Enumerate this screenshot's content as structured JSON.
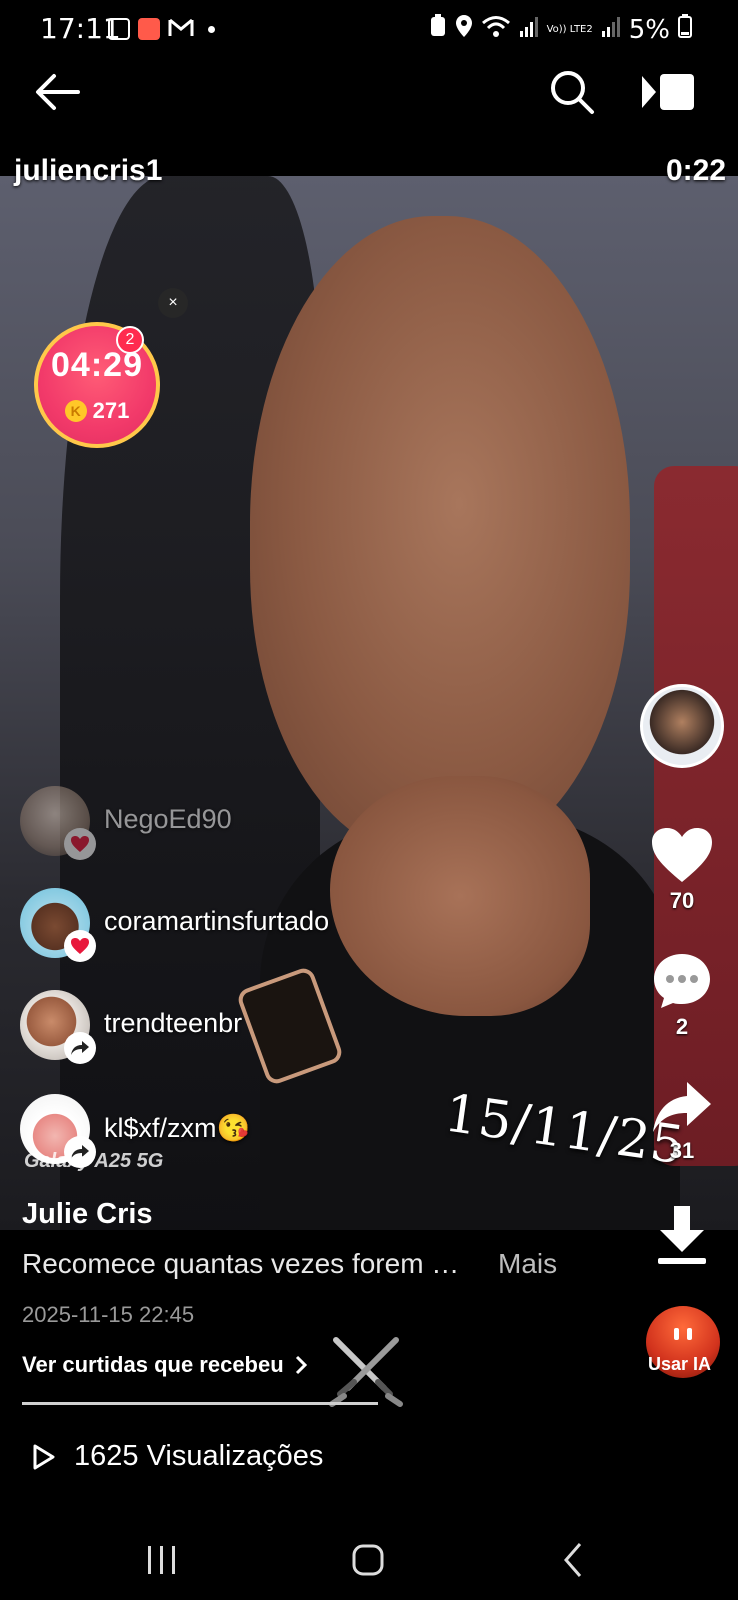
{
  "status_bar": {
    "time": "17:11",
    "battery": "5%",
    "network_label": "Vo)) LTE2"
  },
  "video": {
    "uploader": "juliencris1",
    "duration": "0:22",
    "overlay_date": "15/11/25",
    "device_tag": "Galaxy A25 5G"
  },
  "timer_widget": {
    "time": "04:29",
    "coins": "271",
    "coin_symbol": "K",
    "badge_count": "2",
    "close_symbol": "×"
  },
  "activity_feed": [
    {
      "name": "NegoEd90",
      "action_icon": "heart-icon"
    },
    {
      "name": "coramartinsfurtado",
      "action_icon": "heart-icon"
    },
    {
      "name": "trendteenbr",
      "action_icon": "share-icon"
    },
    {
      "name": "kl$xf/zxm😘",
      "action_icon": "share-icon"
    }
  ],
  "actions": {
    "likes": "70",
    "comments": "2",
    "shares": "31"
  },
  "post": {
    "author": "Julie Cris",
    "caption": "Recomece quantas vezes forem …",
    "more_label": "Mais",
    "date": "2025-11-15 22:45",
    "likes_link": "Ver curtidas que recebeu",
    "progress": 1.0,
    "views": "1625 Visualizações",
    "ai_label": "Usar IA"
  },
  "colors": {
    "timer_bg": "#f23a6a",
    "timer_ring": "#ffc84a",
    "heart_badge": "#e8193c",
    "ai_button": "#d2331d"
  }
}
